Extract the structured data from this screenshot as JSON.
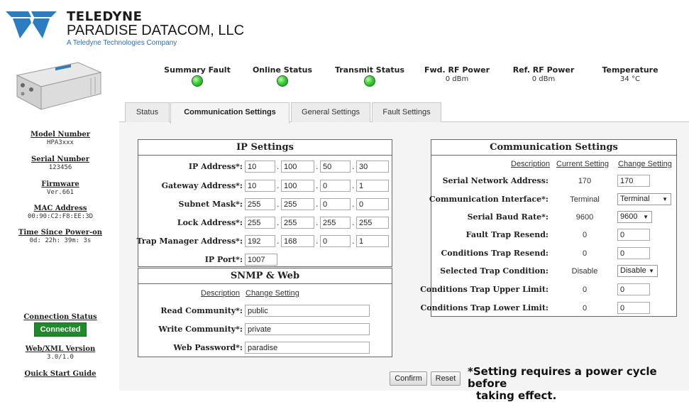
{
  "brand": {
    "name": "TELEDYNE",
    "subname": "PARADISE DATACOM, LLC",
    "tagline": "A Teledyne Technologies Company"
  },
  "sidebar": {
    "model_number": {
      "label": "Model Number",
      "value": "HPA3xxx"
    },
    "serial_number": {
      "label": "Serial Number",
      "value": "123456"
    },
    "firmware": {
      "label": "Firmware",
      "value": "Ver.661"
    },
    "mac_address": {
      "label": "MAC Address",
      "value": "00:90:C2:F8:EE:3D"
    },
    "uptime": {
      "label": "Time Since Power-on",
      "value": "0d: 22h: 39m: 3s"
    },
    "connection": {
      "label": "Connection Status",
      "value": "Connected"
    },
    "webxml": {
      "label": "Web/XML Version",
      "value": "3.0/1.0"
    },
    "quick_start": "Quick Start Guide"
  },
  "status_bar": {
    "summary_fault": "Summary Fault",
    "online_status": "Online Status",
    "transmit_status": "Transmit Status",
    "fwd_rf_power": {
      "label": "Fwd. RF Power",
      "value": "0 dBm"
    },
    "ref_rf_power": {
      "label": "Ref. RF Power",
      "value": "0 dBm"
    },
    "temperature": {
      "label": "Temperature",
      "value": "34 °C"
    },
    "led_color": "#39d03a"
  },
  "tabs": [
    "Status",
    "Communication Settings",
    "General Settings",
    "Fault Settings"
  ],
  "ip_settings": {
    "title": "IP Settings",
    "ip_address": {
      "label": "IP Address*:",
      "octets": [
        "10",
        "100",
        "50",
        "30"
      ]
    },
    "gateway": {
      "label": "Gateway Address*:",
      "octets": [
        "10",
        "100",
        "0",
        "1"
      ]
    },
    "subnet": {
      "label": "Subnet Mask*:",
      "octets": [
        "255",
        "255",
        "0",
        "0"
      ]
    },
    "lock": {
      "label": "Lock Address*:",
      "octets": [
        "255",
        "255",
        "255",
        "255"
      ]
    },
    "trap_manager": {
      "label": "Trap Manager Address*:",
      "octets": [
        "192",
        "168",
        "0",
        "1"
      ]
    },
    "ip_port": {
      "label": "IP Port*:",
      "value": "1007"
    }
  },
  "snmp": {
    "title": "SNMP & Web",
    "desc_header": "Description",
    "change_header": "Change Setting",
    "read_community": {
      "label": "Read Community*:",
      "value": "public"
    },
    "write_community": {
      "label": "Write Community*:",
      "value": "private"
    },
    "web_password": {
      "label": "Web Password*:",
      "value": "paradise"
    }
  },
  "comm_settings": {
    "title": "Communication Settings",
    "desc_header": "Description",
    "current_header": "Current Setting",
    "change_header": "Change Setting",
    "rows": [
      {
        "label": "Serial Network Address:",
        "current": "170",
        "change": "170",
        "kind": "input"
      },
      {
        "label": "Communication Interface*:",
        "current": "Terminal",
        "change": "Terminal",
        "kind": "select"
      },
      {
        "label": "Serial Baud Rate*:",
        "current": "9600",
        "change": "9600",
        "kind": "select"
      },
      {
        "label": "Fault Trap Resend:",
        "current": "0",
        "change": "0",
        "kind": "input"
      },
      {
        "label": "Conditions Trap Resend:",
        "current": "0",
        "change": "0",
        "kind": "input"
      },
      {
        "label": "Selected Trap Condition:",
        "current": "Disable",
        "change": "Disable",
        "kind": "select"
      },
      {
        "label": "Conditions Trap Upper Limit:",
        "current": "0",
        "change": "0",
        "kind": "input"
      },
      {
        "label": "Conditions Trap Lower Limit:",
        "current": "0",
        "change": "0",
        "kind": "input"
      }
    ]
  },
  "actions": {
    "confirm": "Confirm",
    "reset": "Reset",
    "note_line1": "*Setting requires a power cycle before",
    "note_line2": "taking effect."
  }
}
